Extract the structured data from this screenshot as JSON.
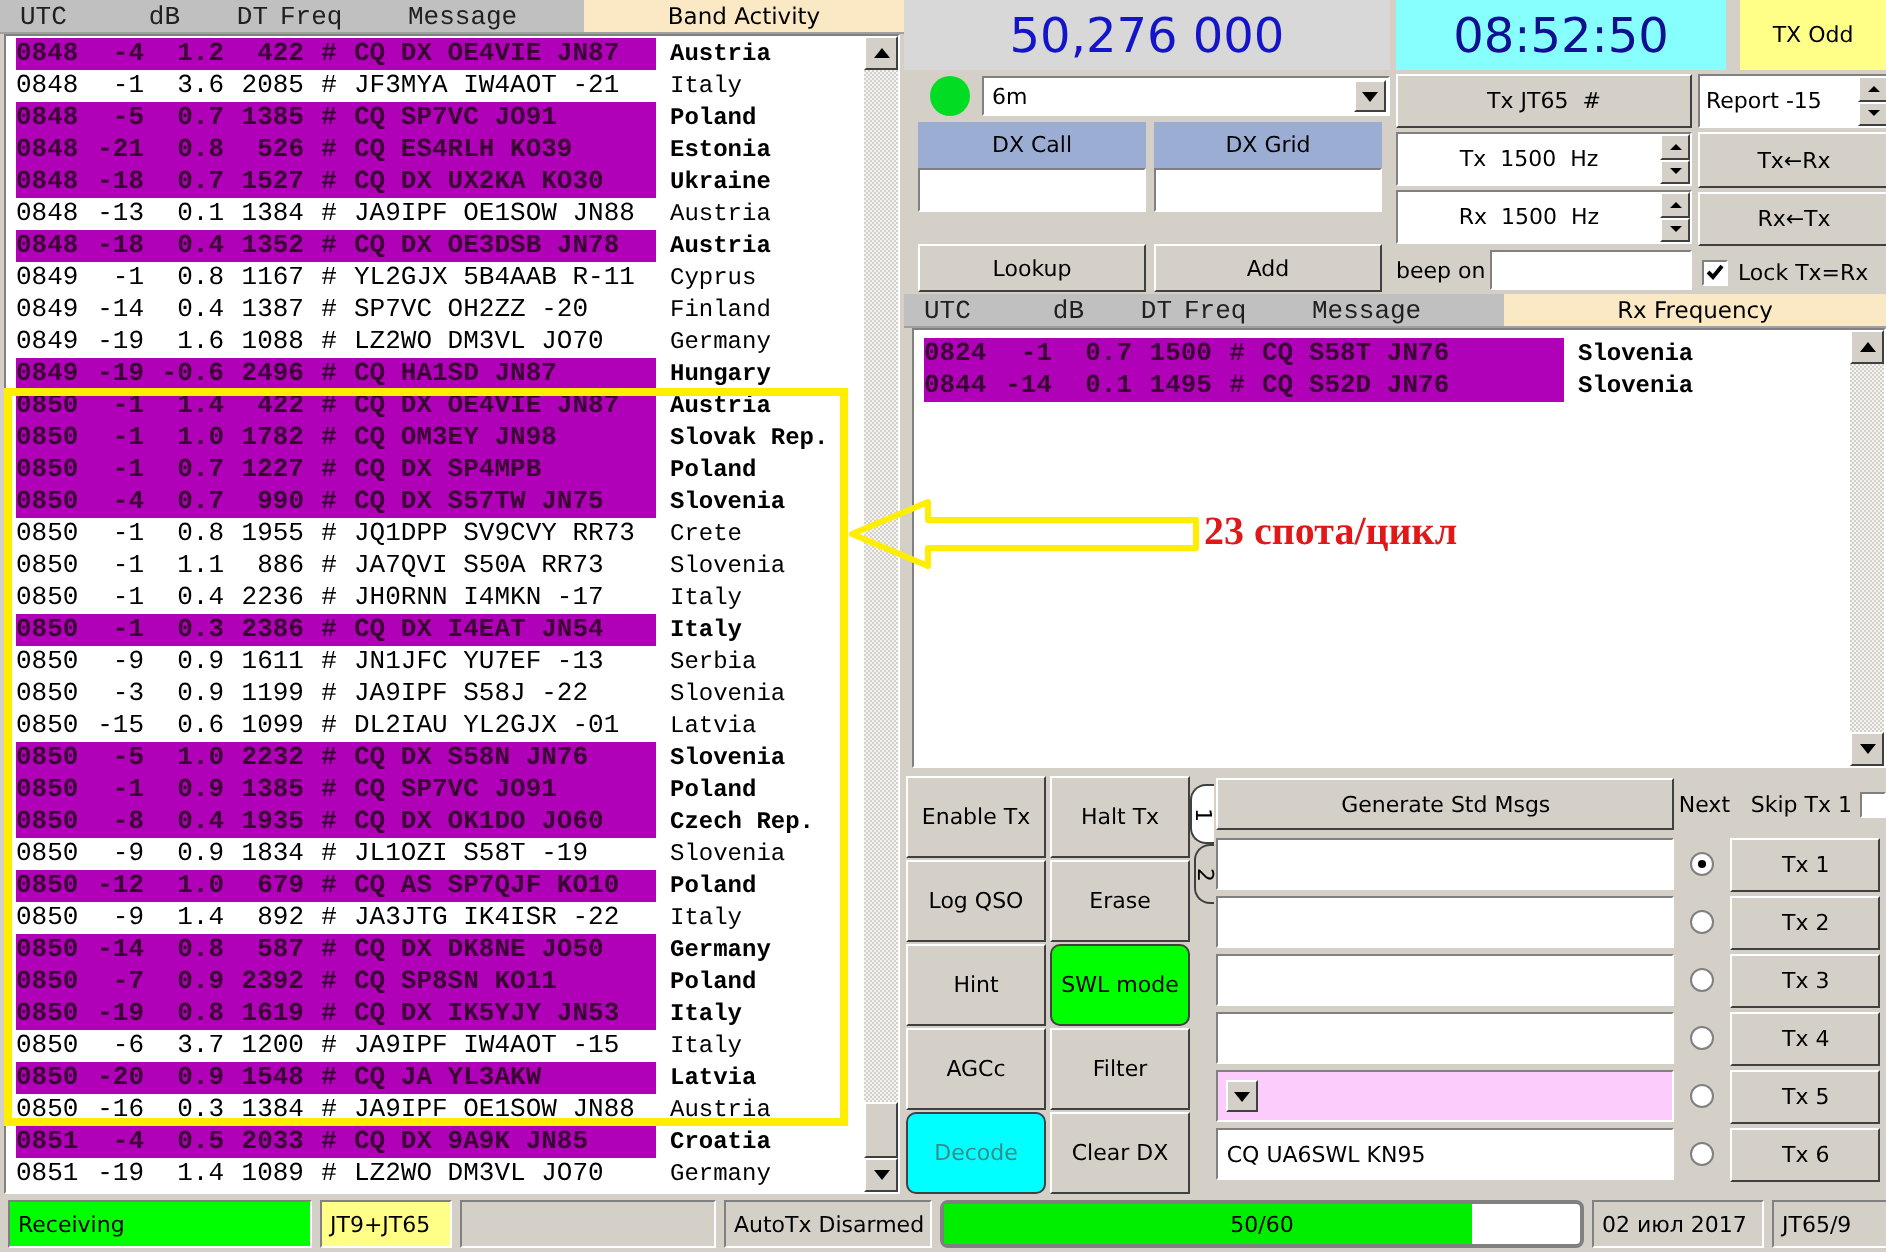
{
  "band_activity": {
    "title": "Band Activity",
    "columns": [
      "UTC",
      "dB",
      "DT",
      "Freq",
      "Message"
    ],
    "rows": [
      {
        "utc": "0848",
        "db": "-4",
        "dt": "1.2",
        "freq": "422",
        "mark": "#",
        "message": "CQ DX OE4VIE JN87",
        "country": "Austria",
        "cq": true
      },
      {
        "utc": "0848",
        "db": "-1",
        "dt": "3.6",
        "freq": "2085",
        "mark": "#",
        "message": "JF3MYA IW4AOT -21",
        "country": "Italy",
        "cq": false
      },
      {
        "utc": "0848",
        "db": "-5",
        "dt": "0.7",
        "freq": "1385",
        "mark": "#",
        "message": "CQ SP7VC JO91",
        "country": "Poland",
        "cq": true
      },
      {
        "utc": "0848",
        "db": "-21",
        "dt": "0.8",
        "freq": "526",
        "mark": "#",
        "message": "CQ ES4RLH KO39",
        "country": "Estonia",
        "cq": true
      },
      {
        "utc": "0848",
        "db": "-18",
        "dt": "0.7",
        "freq": "1527",
        "mark": "#",
        "message": "CQ DX UX2KA KO30",
        "country": "Ukraine",
        "cq": true
      },
      {
        "utc": "0848",
        "db": "-13",
        "dt": "0.1",
        "freq": "1384",
        "mark": "#",
        "message": "JA9IPF OE1SOW JN88",
        "country": "Austria",
        "cq": false
      },
      {
        "utc": "0848",
        "db": "-18",
        "dt": "0.4",
        "freq": "1352",
        "mark": "#",
        "message": "CQ DX OE3DSB JN78",
        "country": "Austria",
        "cq": true
      },
      {
        "utc": "0849",
        "db": "-1",
        "dt": "0.8",
        "freq": "1167",
        "mark": "#",
        "message": "YL2GJX 5B4AAB R-11",
        "country": "Cyprus",
        "cq": false
      },
      {
        "utc": "0849",
        "db": "-14",
        "dt": "0.4",
        "freq": "1387",
        "mark": "#",
        "message": "SP7VC OH2ZZ -20",
        "country": "Finland",
        "cq": false
      },
      {
        "utc": "0849",
        "db": "-19",
        "dt": "1.6",
        "freq": "1088",
        "mark": "#",
        "message": "LZ2WO DM3VL JO70",
        "country": "Germany",
        "cq": false
      },
      {
        "utc": "0849",
        "db": "-19",
        "dt": "-0.6",
        "freq": "2496",
        "mark": "#",
        "message": "CQ HA1SD JN87",
        "country": "Hungary",
        "cq": true
      },
      {
        "utc": "0850",
        "db": "-1",
        "dt": "1.4",
        "freq": "422",
        "mark": "#",
        "message": "CQ DX OE4VIE JN87",
        "country": "Austria",
        "cq": true
      },
      {
        "utc": "0850",
        "db": "-1",
        "dt": "1.0",
        "freq": "1782",
        "mark": "#",
        "message": "CQ OM3EY JN98",
        "country": "Slovak Rep.",
        "cq": true
      },
      {
        "utc": "0850",
        "db": "-1",
        "dt": "0.7",
        "freq": "1227",
        "mark": "#",
        "message": "CQ DX SP4MPB",
        "country": "Poland",
        "cq": true
      },
      {
        "utc": "0850",
        "db": "-4",
        "dt": "0.7",
        "freq": "990",
        "mark": "#",
        "message": "CQ DX S57TW JN75",
        "country": "Slovenia",
        "cq": true
      },
      {
        "utc": "0850",
        "db": "-1",
        "dt": "0.8",
        "freq": "1955",
        "mark": "#",
        "message": "JQ1DPP SV9CVY RR73",
        "country": "Crete",
        "cq": false
      },
      {
        "utc": "0850",
        "db": "-1",
        "dt": "1.1",
        "freq": "886",
        "mark": "#",
        "message": "JA7QVI S50A RR73",
        "country": "Slovenia",
        "cq": false
      },
      {
        "utc": "0850",
        "db": "-1",
        "dt": "0.4",
        "freq": "2236",
        "mark": "#",
        "message": "JH0RNN I4MKN -17",
        "country": "Italy",
        "cq": false
      },
      {
        "utc": "0850",
        "db": "-1",
        "dt": "0.3",
        "freq": "2386",
        "mark": "#",
        "message": "CQ DX I4EAT JN54",
        "country": "Italy",
        "cq": true
      },
      {
        "utc": "0850",
        "db": "-9",
        "dt": "0.9",
        "freq": "1611",
        "mark": "#",
        "message": "JN1JFC YU7EF -13",
        "country": "Serbia",
        "cq": false
      },
      {
        "utc": "0850",
        "db": "-3",
        "dt": "0.9",
        "freq": "1199",
        "mark": "#",
        "message": "JA9IPF S58J -22",
        "country": "Slovenia",
        "cq": false
      },
      {
        "utc": "0850",
        "db": "-15",
        "dt": "0.6",
        "freq": "1099",
        "mark": "#",
        "message": "DL2IAU YL2GJX -01",
        "country": "Latvia",
        "cq": false
      },
      {
        "utc": "0850",
        "db": "-5",
        "dt": "1.0",
        "freq": "2232",
        "mark": "#",
        "message": "CQ DX S58N JN76",
        "country": "Slovenia",
        "cq": true
      },
      {
        "utc": "0850",
        "db": "-1",
        "dt": "0.9",
        "freq": "1385",
        "mark": "#",
        "message": "CQ SP7VC JO91",
        "country": "Poland",
        "cq": true
      },
      {
        "utc": "0850",
        "db": "-8",
        "dt": "0.4",
        "freq": "1935",
        "mark": "#",
        "message": "CQ DX OK1DO JO60",
        "country": "Czech Rep.",
        "cq": true
      },
      {
        "utc": "0850",
        "db": "-9",
        "dt": "0.9",
        "freq": "1834",
        "mark": "#",
        "message": "JL1OZI S58T -19",
        "country": "Slovenia",
        "cq": false
      },
      {
        "utc": "0850",
        "db": "-12",
        "dt": "1.0",
        "freq": "679",
        "mark": "#",
        "message": "CQ AS SP7QJF KO10",
        "country": "Poland",
        "cq": true
      },
      {
        "utc": "0850",
        "db": "-9",
        "dt": "1.4",
        "freq": "892",
        "mark": "#",
        "message": "JA3JTG IK4ISR -22",
        "country": "Italy",
        "cq": false
      },
      {
        "utc": "0850",
        "db": "-14",
        "dt": "0.8",
        "freq": "587",
        "mark": "#",
        "message": "CQ DX DK8NE JO50",
        "country": "Germany",
        "cq": true
      },
      {
        "utc": "0850",
        "db": "-7",
        "dt": "0.9",
        "freq": "2392",
        "mark": "#",
        "message": "CQ SP8SN KO11",
        "country": "Poland",
        "cq": true
      },
      {
        "utc": "0850",
        "db": "-19",
        "dt": "0.8",
        "freq": "1619",
        "mark": "#",
        "message": "CQ DX IK5YJY JN53",
        "country": "Italy",
        "cq": true
      },
      {
        "utc": "0850",
        "db": "-6",
        "dt": "3.7",
        "freq": "1200",
        "mark": "#",
        "message": "JA9IPF IW4AOT -15",
        "country": "Italy",
        "cq": false
      },
      {
        "utc": "0850",
        "db": "-20",
        "dt": "0.9",
        "freq": "1548",
        "mark": "#",
        "message": "CQ JA YL3AKW",
        "country": "Latvia",
        "cq": true
      },
      {
        "utc": "0850",
        "db": "-16",
        "dt": "0.3",
        "freq": "1384",
        "mark": "#",
        "message": "JA9IPF OE1SOW JN88",
        "country": "Austria",
        "cq": false
      },
      {
        "utc": "0851",
        "db": "-4",
        "dt": "0.5",
        "freq": "2033",
        "mark": "#",
        "message": "CQ DX 9A9K JN85",
        "country": "Croatia",
        "cq": true
      },
      {
        "utc": "0851",
        "db": "-19",
        "dt": "1.4",
        "freq": "1089",
        "mark": "#",
        "message": "LZ2WO DM3VL JO70",
        "country": "Germany",
        "cq": false
      }
    ]
  },
  "annotation": {
    "text": "23 спота/цикл"
  },
  "frequency": "50,276 000",
  "clock": "08:52:50",
  "tx_parity": "TX Odd",
  "monitor_on": true,
  "band": {
    "value": "6m"
  },
  "dx_call": {
    "label": "DX Call"
  },
  "dx_grid": {
    "label": "DX Grid"
  },
  "lookup_button": "Lookup",
  "add_button": "Add",
  "tx_mode_button": "Tx JT65  #",
  "report": "Report -15",
  "tx_freq": "Tx  1500  Hz",
  "rx_freq": "Rx  1500  Hz",
  "tx_from_rx_button": "Tx←Rx",
  "rx_from_tx_button": "Rx←Tx",
  "beep_on": {
    "label": "beep on"
  },
  "lock": {
    "label": "Lock Tx=Rx",
    "checked": true
  },
  "rx_frequency": {
    "title": "Rx Frequency",
    "columns": [
      "UTC",
      "dB",
      "DT",
      "Freq",
      "Message"
    ],
    "rows": [
      {
        "utc": "0824",
        "db": "-1",
        "dt": "0.7",
        "freq": "1500",
        "mark": "#",
        "message": "CQ S58T JN76",
        "country": "Slovenia",
        "cq": true
      },
      {
        "utc": "0844",
        "db": "-14",
        "dt": "0.1",
        "freq": "1495",
        "mark": "#",
        "message": "CQ S52D JN76",
        "country": "Slovenia",
        "cq": true
      }
    ]
  },
  "control_buttons": [
    {
      "label": "Enable Tx"
    },
    {
      "label": "Halt Tx"
    },
    {
      "label": "Log QSO"
    },
    {
      "label": "Erase"
    },
    {
      "label": "Hint"
    },
    {
      "label": "SWL mode",
      "color": "#00ff00"
    },
    {
      "label": "AGCc"
    },
    {
      "label": "Filter"
    },
    {
      "label": "Decode",
      "color": "#00ffff"
    },
    {
      "label": "Clear DX"
    }
  ],
  "tabs": [
    {
      "label": "1",
      "selected": true
    },
    {
      "label": "2",
      "selected": false
    }
  ],
  "generate_button": "Generate Std Msgs",
  "next_label": "Next",
  "skip_tx1": {
    "label": "Skip Tx 1",
    "checked": false
  },
  "messages": [
    {
      "kind": "field",
      "selected": true,
      "button": "Tx 1"
    },
    {
      "kind": "field",
      "selected": false,
      "button": "Tx 2"
    },
    {
      "kind": "field",
      "selected": false,
      "button": "Tx 3"
    },
    {
      "kind": "field",
      "selected": false,
      "button": "Tx 4"
    },
    {
      "kind": "combo",
      "selected": false,
      "button": "Tx 5"
    },
    {
      "kind": "field",
      "value": "CQ UA6SWL KN95",
      "selected": false,
      "button": "Tx 6"
    }
  ],
  "status_bar": {
    "state": "Receiving",
    "mode": "JT9+JT65",
    "autotx": "AutoTx Disarmed",
    "progress": {
      "label": "50/60",
      "level": 0.83
    },
    "date": "02 июл 2017",
    "mode_info": "JT65/9"
  }
}
